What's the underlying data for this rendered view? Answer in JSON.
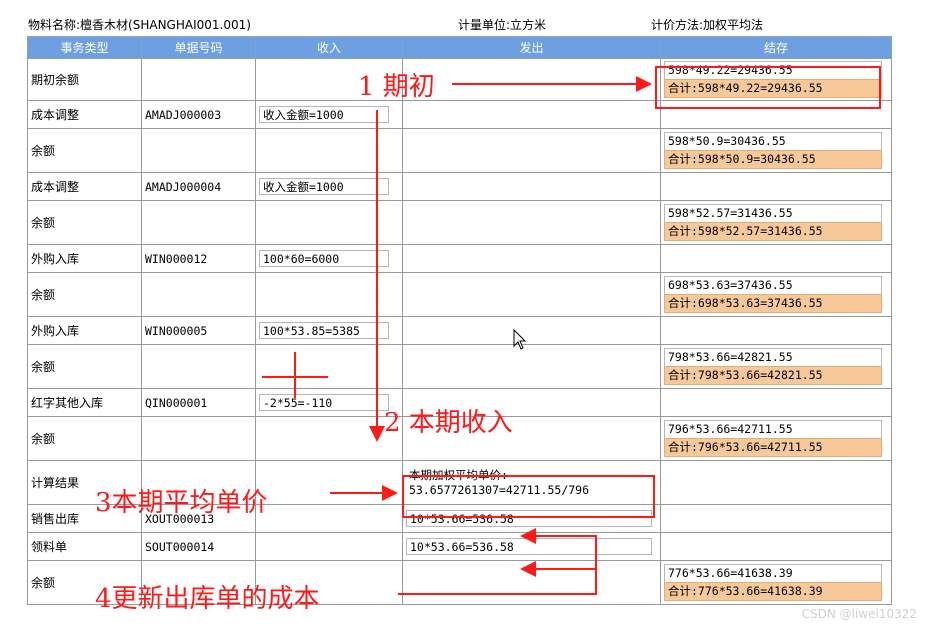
{
  "header": {
    "material": "物料名称:檀香木材(SHANGHAI001.001)",
    "unit": "计量单位:立方米",
    "method": "计价方法:加权平均法"
  },
  "table": {
    "columns": [
      "事务类型",
      "单据号码",
      "收入",
      "发出",
      "结存"
    ],
    "rows": [
      {
        "type": "期初余额",
        "doc": "",
        "in": "",
        "out": "",
        "stock": "598*49.22=29436.55",
        "total": "合计:598*49.22=29436.55"
      },
      {
        "type": "成本调整",
        "doc": "AMADJ000003",
        "in": "收入金额=1000",
        "out": "",
        "stock": "",
        "total": ""
      },
      {
        "type": "余额",
        "doc": "",
        "in": "",
        "out": "",
        "stock": "598*50.9=30436.55",
        "total": "合计:598*50.9=30436.55"
      },
      {
        "type": "成本调整",
        "doc": "AMADJ000004",
        "in": "收入金额=1000",
        "out": "",
        "stock": "",
        "total": ""
      },
      {
        "type": "余额",
        "doc": "",
        "in": "",
        "out": "",
        "stock": "598*52.57=31436.55",
        "total": "合计:598*52.57=31436.55"
      },
      {
        "type": "外购入库",
        "doc": "WIN000012",
        "in": "100*60=6000",
        "out": "",
        "stock": "",
        "total": ""
      },
      {
        "type": "余额",
        "doc": "",
        "in": "",
        "out": "",
        "stock": "698*53.63=37436.55",
        "total": "合计:698*53.63=37436.55"
      },
      {
        "type": "外购入库",
        "doc": "WIN000005",
        "in": "100*53.85=5385",
        "out": "",
        "stock": "",
        "total": ""
      },
      {
        "type": "余额",
        "doc": "",
        "in": "",
        "out": "",
        "stock": "798*53.66=42821.55",
        "total": "合计:798*53.66=42821.55"
      },
      {
        "type": "红字其他入库",
        "doc": "QIN000001",
        "in": "-2*55=-110",
        "out": "",
        "stock": "",
        "total": ""
      },
      {
        "type": "余额",
        "doc": "",
        "in": "",
        "out": "",
        "stock": "796*53.66=42711.55",
        "total": "合计:796*53.66=42711.55"
      },
      {
        "type": "计算结果",
        "doc": "",
        "in": "",
        "out_title": "本期加权平均单价:",
        "out": "53.6577261307=42711.55/796",
        "stock": "",
        "total": ""
      },
      {
        "type": "销售出库",
        "doc": "XOUT000013",
        "in": "",
        "out": "10*53.66=536.58",
        "stock": "",
        "total": ""
      },
      {
        "type": "领料单",
        "doc": "SOUT000014",
        "in": "",
        "out": "10*53.66=536.58",
        "stock": "",
        "total": ""
      },
      {
        "type": "余额",
        "doc": "",
        "in": "",
        "out": "",
        "stock": "776*53.66=41638.39",
        "total": "合计:776*53.66=41638.39"
      }
    ]
  },
  "annotations": {
    "a1": "1  期初",
    "a2": "2  本期收入",
    "a3": "3本期平均单价",
    "a4": "4更新出库单的成本"
  },
  "watermark": "CSDN @liwei10322",
  "colors": {
    "header_bg": "#6E9FE0",
    "total_bg": "#F7C898",
    "annotation": "#ff1a1a"
  }
}
